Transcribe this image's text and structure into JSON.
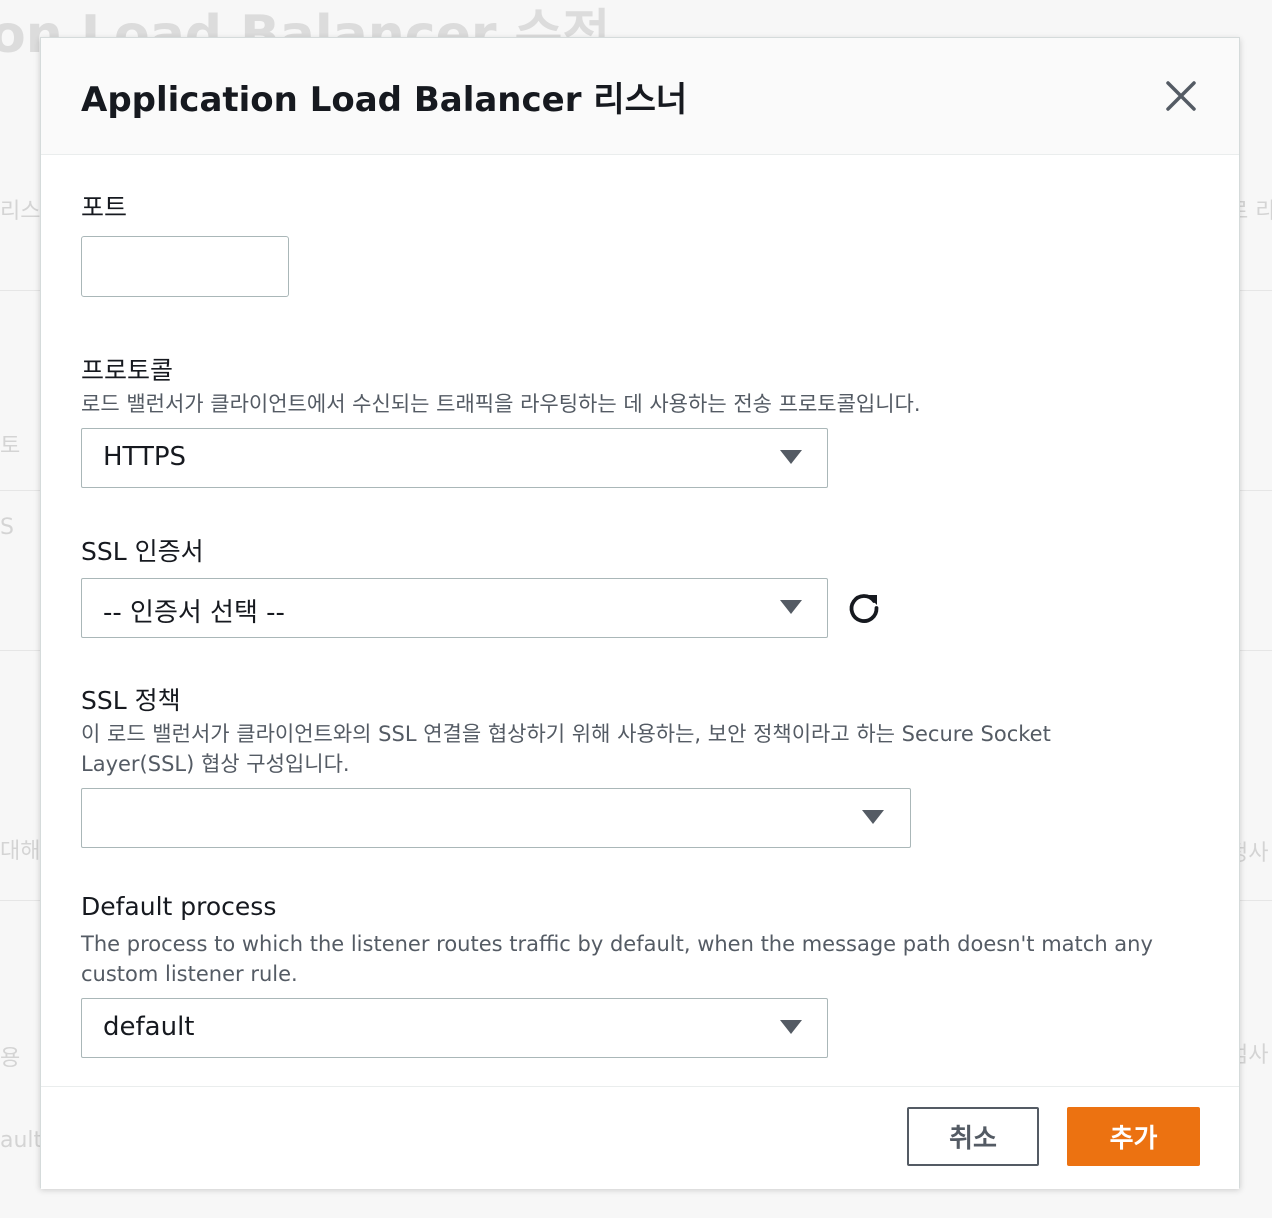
{
  "background": {
    "title": "on Load Balancer 수정",
    "left_texts": [
      "리스",
      "토",
      "S",
      "대해",
      "용",
      "ault"
    ],
    "right_texts": [
      "로 리",
      "정사",
      "검사"
    ]
  },
  "modal": {
    "title": "Application Load Balancer 리스너",
    "close_icon": "close-icon"
  },
  "fields": {
    "port": {
      "label": "포트",
      "value": ""
    },
    "protocol": {
      "label": "프로토콜",
      "description": "로드 밸런서가 클라이언트에서 수신되는 트래픽을 라우팅하는 데 사용하는 전송 프로토콜입니다.",
      "value": "HTTPS"
    },
    "ssl_certificate": {
      "label": "SSL 인증서",
      "value": "-- 인증서 선택 --",
      "refresh_icon": "refresh-icon"
    },
    "ssl_policy": {
      "label": "SSL 정책",
      "description": "이 로드 밸런서가 클라이언트와의 SSL 연결을 협상하기 위해 사용하는, 보안 정책이라고 하는 Secure Socket Layer(SSL) 협상 구성입니다.",
      "value": ""
    },
    "default_process": {
      "label": "Default process",
      "description": "The process to which the listener routes traffic by default, when the message path doesn't match any custom listener rule.",
      "value": "default"
    }
  },
  "footer": {
    "cancel_label": "취소",
    "add_label": "추가"
  },
  "colors": {
    "primary_button": "#ec7211",
    "text": "#16191f",
    "muted_text": "#545b64",
    "border": "#aab7b8"
  }
}
